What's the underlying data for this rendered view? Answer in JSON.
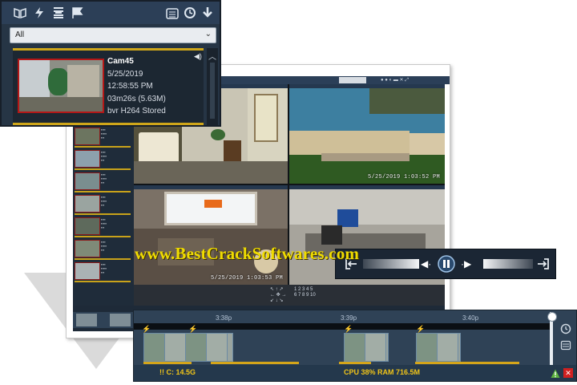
{
  "event_panel": {
    "toolbar_icons": [
      "book-icon",
      "lightning-icon",
      "ladder-icon",
      "flag-icon",
      "calendar-icon",
      "shield-clock-icon",
      "download-arrow-icon"
    ],
    "filter": {
      "selected": "All"
    },
    "event": {
      "camera": "Cam45",
      "date": "5/25/2019",
      "time": "12:58:55 PM",
      "duration": "03m26s (5.63M)",
      "format": "bvr H264 Stored"
    }
  },
  "camera_views": [
    {
      "timestamp": ""
    },
    {
      "timestamp": "5/25/2019 1:03:52 PM"
    },
    {
      "timestamp": "5/25/2019 1:03:53 PM"
    },
    {
      "timestamp": ""
    }
  ],
  "playback": {
    "icons": [
      "exit-left-icon",
      "rewind-icon",
      "pause-icon",
      "forward-icon",
      "exit-right-icon"
    ]
  },
  "timeline": {
    "ticks": [
      "3:38p",
      "3:39p",
      "3:40p"
    ],
    "storage": "!! C:  14.5G",
    "stats": "CPU 38% RAM 716.5M",
    "icons": [
      "clock-icon",
      "calendar-icon",
      "warning-icon",
      "close-icon"
    ]
  },
  "watermark": "www.BestCrackSoftwares.com",
  "colors": {
    "accent_yellow": "#cfa61a",
    "panel_dark": "#1c2732",
    "toolbar_blue": "#2c3f57",
    "record_red": "#b41717"
  }
}
